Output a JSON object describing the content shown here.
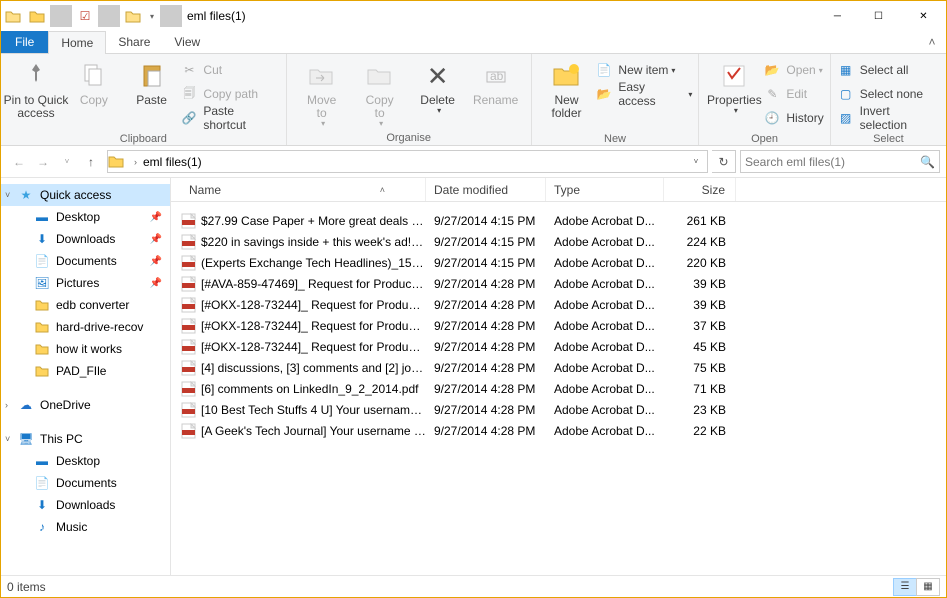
{
  "window": {
    "title": "eml files(1)"
  },
  "tabs": {
    "file": "File",
    "home": "Home",
    "share": "Share",
    "view": "View"
  },
  "ribbon": {
    "pin": "Pin to Quick\naccess",
    "copy": "Copy",
    "paste": "Paste",
    "cut": "Cut",
    "copypath": "Copy path",
    "pasteshortcut": "Paste shortcut",
    "clipboard_group": "Clipboard",
    "moveto": "Move\nto",
    "copyto": "Copy\nto",
    "delete": "Delete",
    "rename": "Rename",
    "organise_group": "Organise",
    "newfolder": "New\nfolder",
    "newitem": "New item",
    "easyaccess": "Easy access",
    "new_group": "New",
    "properties": "Properties",
    "open": "Open",
    "edit": "Edit",
    "history": "History",
    "open_group": "Open",
    "selectall": "Select all",
    "selectnone": "Select none",
    "invert": "Invert selection",
    "select_group": "Select"
  },
  "addr": {
    "crumb": "eml files(1)",
    "search_placeholder": "Search eml files(1)"
  },
  "columns": {
    "name": "Name",
    "date": "Date modified",
    "type": "Type",
    "size": "Size"
  },
  "nav": {
    "quickaccess": "Quick access",
    "desktop": "Desktop",
    "downloads": "Downloads",
    "documents": "Documents",
    "pictures": "Pictures",
    "edb": "edb converter",
    "hdr": "hard-drive-recov",
    "how": "how it works",
    "pad": "PAD_FIle",
    "onedrive": "OneDrive",
    "thispc": "This PC",
    "pc_desktop": "Desktop",
    "pc_docs": "Documents",
    "pc_down": "Downloads",
    "pc_music": "Music"
  },
  "files": [
    {
      "name": "$27.99 Case Paper + More great deals to ...",
      "date": "9/27/2014 4:15 PM",
      "type": "Adobe Acrobat D...",
      "size": "261 KB"
    },
    {
      "name": "$220 in savings inside + this week's ad!_2...",
      "date": "9/27/2014 4:15 PM",
      "type": "Adobe Acrobat D...",
      "size": "224 KB"
    },
    {
      "name": "(Experts Exchange Tech Headlines)_15_11...",
      "date": "9/27/2014 4:15 PM",
      "type": "Adobe Acrobat D...",
      "size": "220 KB"
    },
    {
      "name": "[#AVA-859-47469]_ Request for Product ...",
      "date": "9/27/2014 4:28 PM",
      "type": "Adobe Acrobat D...",
      "size": "39 KB"
    },
    {
      "name": "[#OKX-128-73244]_ Request for Product ...",
      "date": "9/27/2014 4:28 PM",
      "type": "Adobe Acrobat D...",
      "size": "39 KB"
    },
    {
      "name": "[#OKX-128-73244]_ Request for Product ...",
      "date": "9/27/2014 4:28 PM",
      "type": "Adobe Acrobat D...",
      "size": "37 KB"
    },
    {
      "name": "[#OKX-128-73244]_ Request for Product ...",
      "date": "9/27/2014 4:28 PM",
      "type": "Adobe Acrobat D...",
      "size": "45 KB"
    },
    {
      "name": "[4] discussions, [3] comments and [2] job...",
      "date": "9/27/2014 4:28 PM",
      "type": "Adobe Acrobat D...",
      "size": "75 KB"
    },
    {
      "name": "[6] comments on LinkedIn_9_2_2014.pdf",
      "date": "9/27/2014 4:28 PM",
      "type": "Adobe Acrobat D...",
      "size": "71 KB"
    },
    {
      "name": "[10 Best Tech Stuffs 4 U] Your username ...",
      "date": "9/27/2014 4:28 PM",
      "type": "Adobe Acrobat D...",
      "size": "23 KB"
    },
    {
      "name": "[A Geek's Tech Journal] Your username a...",
      "date": "9/27/2014 4:28 PM",
      "type": "Adobe Acrobat D...",
      "size": "22 KB"
    }
  ],
  "status": {
    "items": "0 items"
  }
}
